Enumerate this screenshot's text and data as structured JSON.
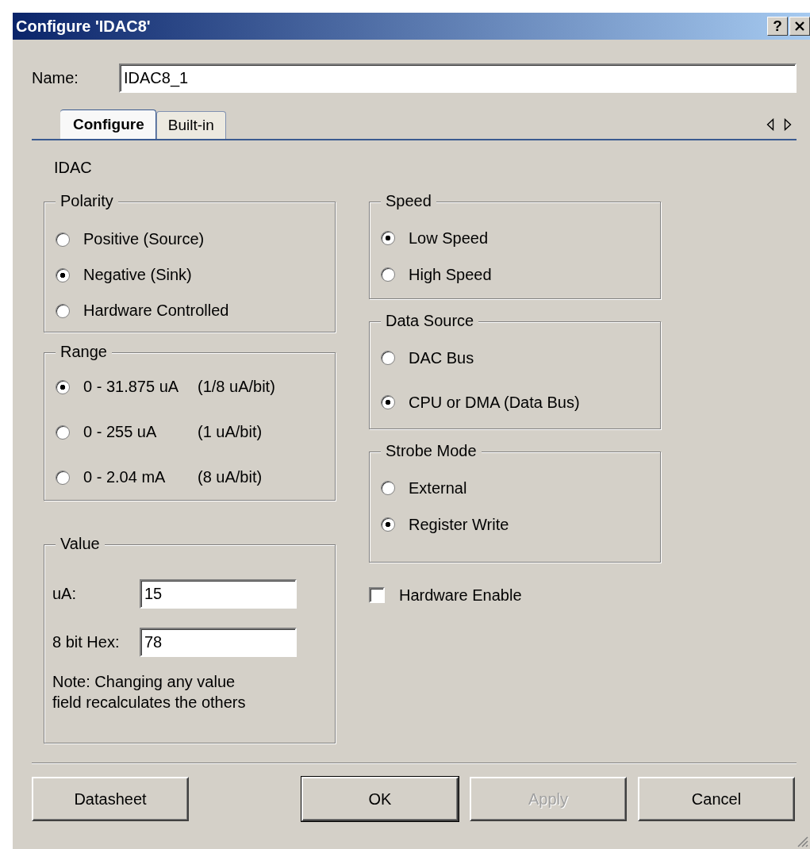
{
  "window": {
    "title": "Configure 'IDAC8'",
    "help_button": "?"
  },
  "name_field": {
    "label": "Name:",
    "value": "IDAC8_1"
  },
  "tabs": [
    {
      "label": "Configure",
      "selected": true
    },
    {
      "label": "Built-in",
      "selected": false
    }
  ],
  "section_title": "IDAC",
  "polarity": {
    "title": "Polarity",
    "options": [
      {
        "label": "Positive (Source)",
        "selected": false
      },
      {
        "label": "Negative (Sink)",
        "selected": true
      },
      {
        "label": "Hardware Controlled",
        "selected": false
      }
    ]
  },
  "range": {
    "title": "Range",
    "options": [
      {
        "label": "0 - 31.875 uA",
        "rate": "(1/8 uA/bit)",
        "selected": true
      },
      {
        "label": "0 - 255 uA",
        "rate": "(1 uA/bit)",
        "selected": false
      },
      {
        "label": "0 - 2.04 mA",
        "rate": "(8 uA/bit)",
        "selected": false
      }
    ]
  },
  "value": {
    "title": "Value",
    "fields": [
      {
        "label": "uA:",
        "value": "15"
      },
      {
        "label": "8 bit Hex:",
        "value": "78"
      }
    ],
    "note": "Note: Changing any value field recalculates the others"
  },
  "speed": {
    "title": "Speed",
    "options": [
      {
        "label": "Low Speed",
        "selected": true
      },
      {
        "label": "High Speed",
        "selected": false
      }
    ]
  },
  "data_source": {
    "title": "Data Source",
    "options": [
      {
        "label": "DAC Bus",
        "selected": false
      },
      {
        "label": "CPU or DMA (Data Bus)",
        "selected": true
      }
    ]
  },
  "strobe_mode": {
    "title": "Strobe Mode",
    "options": [
      {
        "label": "External",
        "selected": false
      },
      {
        "label": "Register Write",
        "selected": true
      }
    ]
  },
  "hardware_enable": {
    "label": "Hardware Enable",
    "checked": false
  },
  "buttons": [
    {
      "label": "Datasheet",
      "disabled": false,
      "default": false
    },
    {
      "label": "OK",
      "disabled": false,
      "default": true
    },
    {
      "label": "Apply",
      "disabled": true,
      "default": false
    },
    {
      "label": "Cancel",
      "disabled": false,
      "default": false
    }
  ]
}
